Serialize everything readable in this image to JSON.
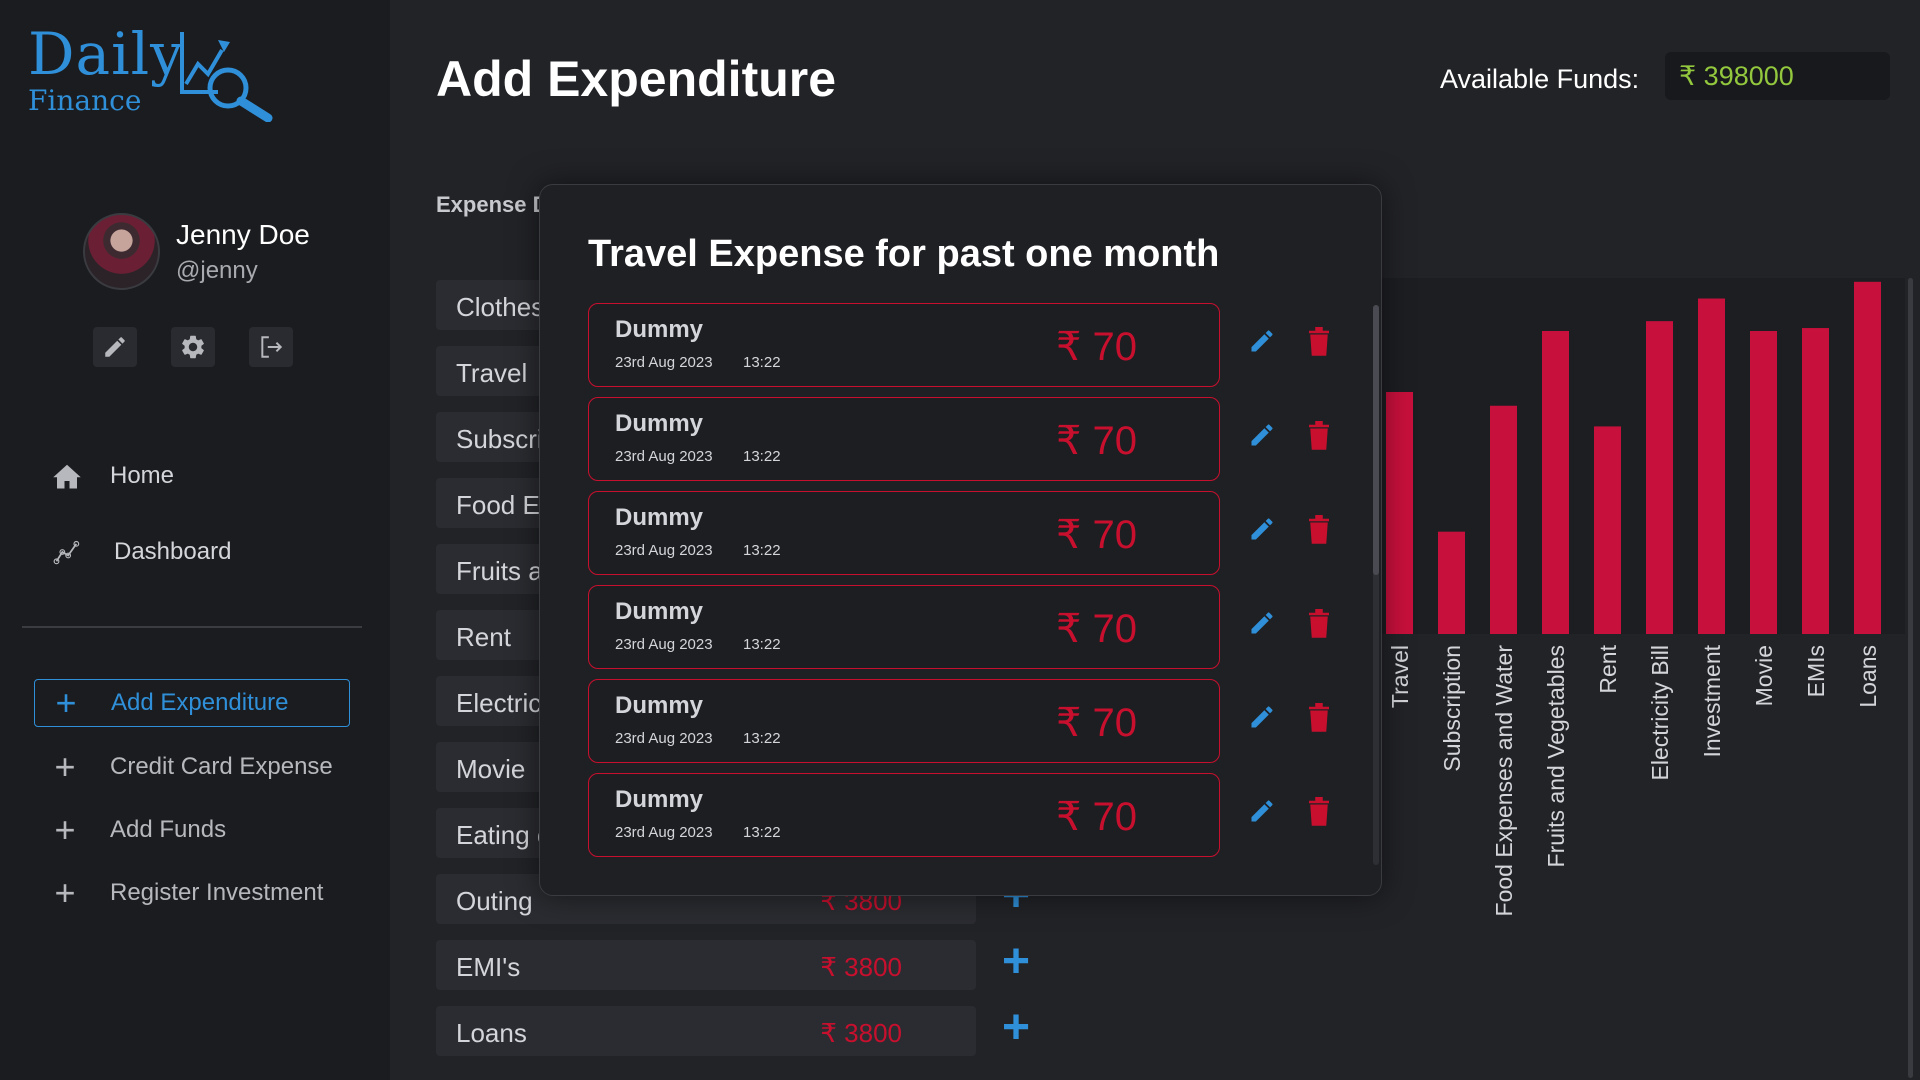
{
  "app": {
    "logo_main": "Daily",
    "logo_sub": "Finance"
  },
  "profile": {
    "name": "Jenny Doe",
    "username": "@jenny"
  },
  "nav": [
    {
      "label": "Home",
      "icon": "home-icon"
    },
    {
      "label": "Dashboard",
      "icon": "chart-line-icon"
    }
  ],
  "actions": [
    {
      "label": "Add Expenditure",
      "active": true
    },
    {
      "label": "Credit Card Expense",
      "active": false
    },
    {
      "label": "Add Funds",
      "active": false
    },
    {
      "label": "Register Investment",
      "active": false
    }
  ],
  "header": {
    "title": "Add Expenditure",
    "funds_label": "Available Funds:",
    "funds_value": "₹ 398000"
  },
  "expense_section_label": "Expense D",
  "expenses": [
    {
      "name": "Clothes",
      "amount": ""
    },
    {
      "name": "Travel",
      "amount": ""
    },
    {
      "name": "Subscri",
      "amount": ""
    },
    {
      "name": "Food Ex",
      "amount": ""
    },
    {
      "name": "Fruits a",
      "amount": ""
    },
    {
      "name": "Rent",
      "amount": ""
    },
    {
      "name": "Electric",
      "amount": ""
    },
    {
      "name": "Movie",
      "amount": ""
    },
    {
      "name": "Eating o",
      "amount": ""
    },
    {
      "name": "Outing",
      "amount": "₹ 3800"
    },
    {
      "name": "EMI's",
      "amount": "₹ 3800"
    },
    {
      "name": "Loans",
      "amount": "₹ 3800"
    }
  ],
  "chart_data": {
    "type": "bar",
    "categories": [
      "Travel",
      "Subscription",
      "Food Expenses and Water",
      "Fruits and Vegetables",
      "Rent",
      "Electricity Bill",
      "Investment",
      "Movie",
      "EMIs",
      "Loans"
    ],
    "values": [
      246,
      104,
      232,
      308,
      211,
      318,
      341,
      308,
      311,
      358
    ],
    "bar_color": "#c8103c"
  },
  "modal": {
    "title": "Travel Expense for past one month",
    "entries": [
      {
        "name": "Dummy",
        "date": "23rd Aug 2023",
        "time": "13:22",
        "amount": "₹ 70"
      },
      {
        "name": "Dummy",
        "date": "23rd Aug 2023",
        "time": "13:22",
        "amount": "₹ 70"
      },
      {
        "name": "Dummy",
        "date": "23rd Aug 2023",
        "time": "13:22",
        "amount": "₹ 70"
      },
      {
        "name": "Dummy",
        "date": "23rd Aug 2023",
        "time": "13:22",
        "amount": "₹ 70"
      },
      {
        "name": "Dummy",
        "date": "23rd Aug 2023",
        "time": "13:22",
        "amount": "₹ 70"
      },
      {
        "name": "Dummy",
        "date": "23rd Aug 2023",
        "time": "13:22",
        "amount": "₹ 70"
      }
    ]
  },
  "colors": {
    "accent": "#2f8fd8",
    "expense_red": "#c8102e",
    "funds_green": "#93c83e"
  }
}
